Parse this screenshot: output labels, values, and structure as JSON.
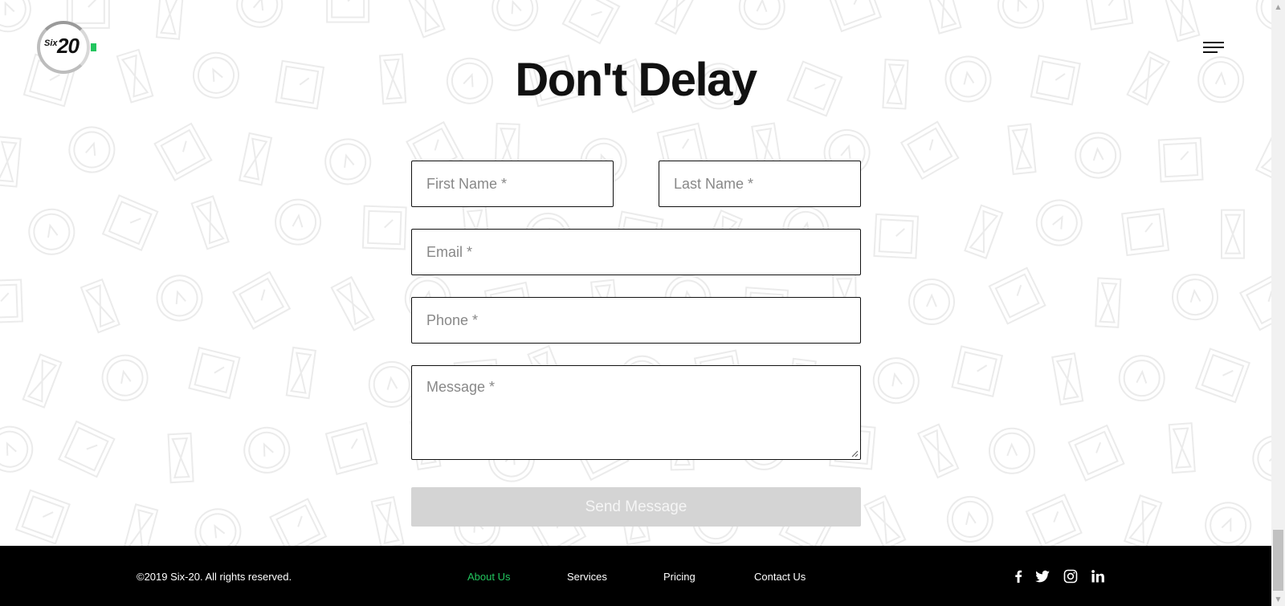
{
  "brand": {
    "logo_small": "Six",
    "logo_large": "20",
    "accent_color": "#22c55e"
  },
  "header": {
    "menu_icon": "hamburger-menu-icon"
  },
  "contact_form": {
    "title": "Don't Delay",
    "first_name_placeholder": "First Name *",
    "last_name_placeholder": "Last Name *",
    "email_placeholder": "Email *",
    "phone_placeholder": "Phone *",
    "message_placeholder": "Message *",
    "submit_label": "Send Message"
  },
  "footer": {
    "copyright": "©2019 Six-20. All rights reserved.",
    "nav": [
      {
        "label": "About Us",
        "active": true
      },
      {
        "label": "Services",
        "active": false
      },
      {
        "label": "Pricing",
        "active": false
      },
      {
        "label": "Contact Us",
        "active": false
      }
    ],
    "social_icons": [
      "facebook-icon",
      "twitter-icon",
      "instagram-icon",
      "linkedin-icon"
    ]
  }
}
